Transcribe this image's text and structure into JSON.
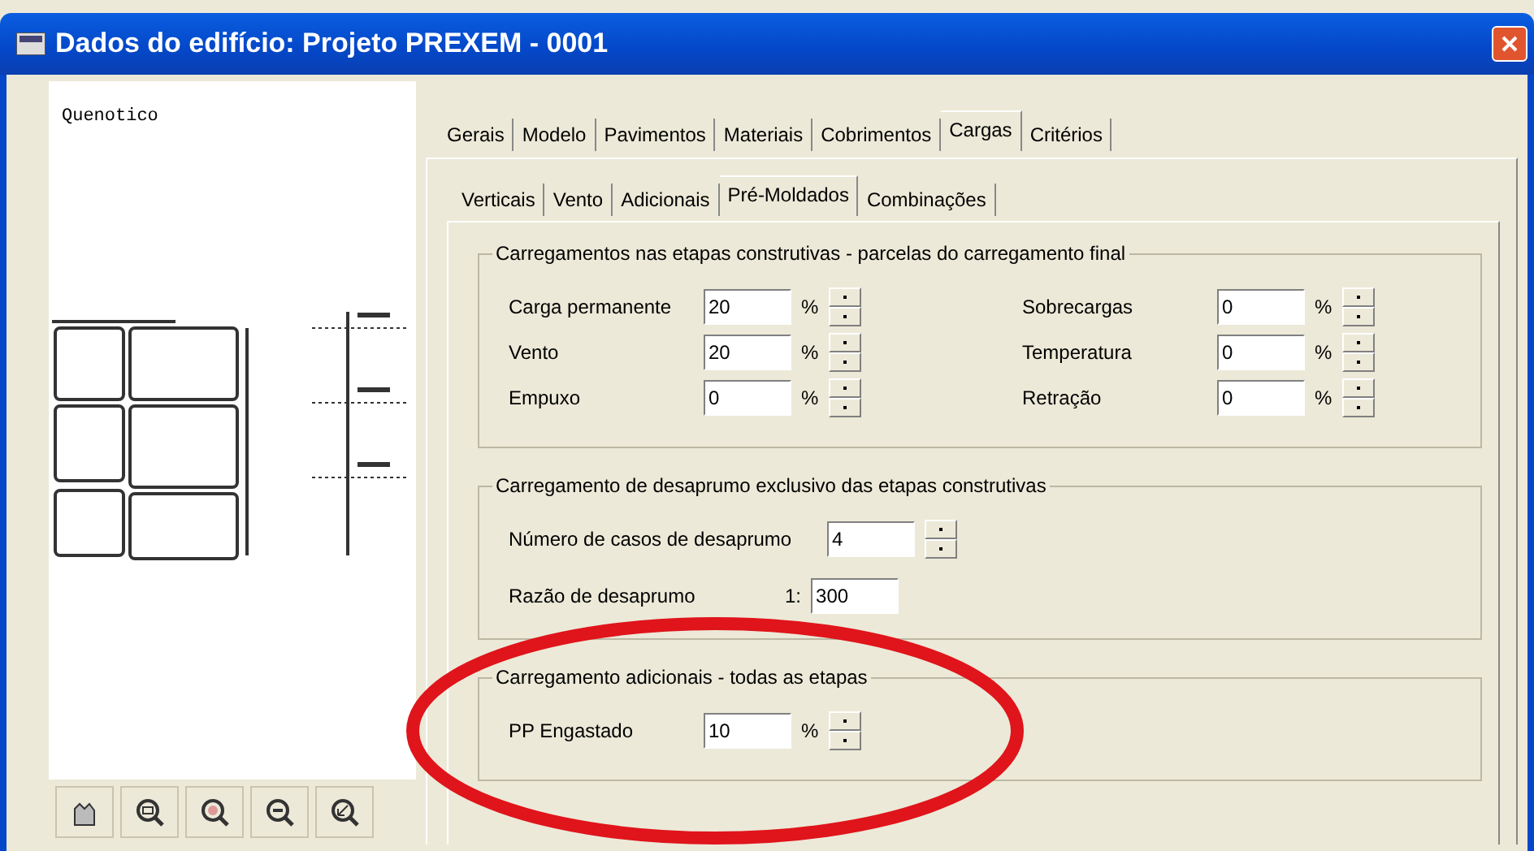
{
  "window": {
    "title": "Dados do edifício: Projeto PREXEM - 0001"
  },
  "preview": {
    "caption": "Quenotico"
  },
  "preview_tools": [
    {
      "kind": "pan"
    },
    {
      "kind": "zoom-window"
    },
    {
      "kind": "zoom-all"
    },
    {
      "kind": "zoom-out"
    },
    {
      "kind": "zoom-previous"
    }
  ],
  "tabs": [
    {
      "label": "Gerais",
      "selected": false
    },
    {
      "label": "Modelo",
      "selected": false
    },
    {
      "label": "Pavimentos",
      "selected": false
    },
    {
      "label": "Materiais",
      "selected": false
    },
    {
      "label": "Cobrimentos",
      "selected": false
    },
    {
      "label": "Cargas",
      "selected": true
    },
    {
      "label": "Critérios",
      "selected": false
    }
  ],
  "subtabs": [
    {
      "label": "Verticais",
      "selected": false
    },
    {
      "label": "Vento",
      "selected": false
    },
    {
      "label": "Adicionais",
      "selected": false
    },
    {
      "label": "Pré-Moldados",
      "selected": true
    },
    {
      "label": "Combinações",
      "selected": false
    }
  ],
  "groups": [
    {
      "title": "Carregamentos nas etapas construtivas - parcelas do carregamento final",
      "fields": [
        {
          "label": "Carga permanente",
          "value": "20",
          "unit": "%",
          "spinner": true
        },
        {
          "label": "Sobrecargas",
          "value": "0",
          "unit": "%",
          "spinner": true
        },
        {
          "label": "Vento",
          "value": "20",
          "unit": "%",
          "spinner": true
        },
        {
          "label": "Temperatura",
          "value": "0",
          "unit": "%",
          "spinner": true
        },
        {
          "label": "Empuxo",
          "value": "0",
          "unit": "%",
          "spinner": true
        },
        {
          "label": "Retração",
          "value": "0",
          "unit": "%",
          "spinner": true
        }
      ]
    },
    {
      "title": "Carregamento de desaprumo exclusivo das etapas construtivas",
      "fields": [
        {
          "label": "Número de casos de desaprumo",
          "value": "4",
          "spinner": true
        },
        {
          "label": "Razão de desaprumo",
          "prefix": "1:",
          "value": "300",
          "spinner": false
        }
      ]
    },
    {
      "title": "Carregamento adicionais - todas as etapas",
      "fields": [
        {
          "label": "PP Engastado",
          "value": "10",
          "unit": "%",
          "spinner": true
        }
      ]
    }
  ]
}
